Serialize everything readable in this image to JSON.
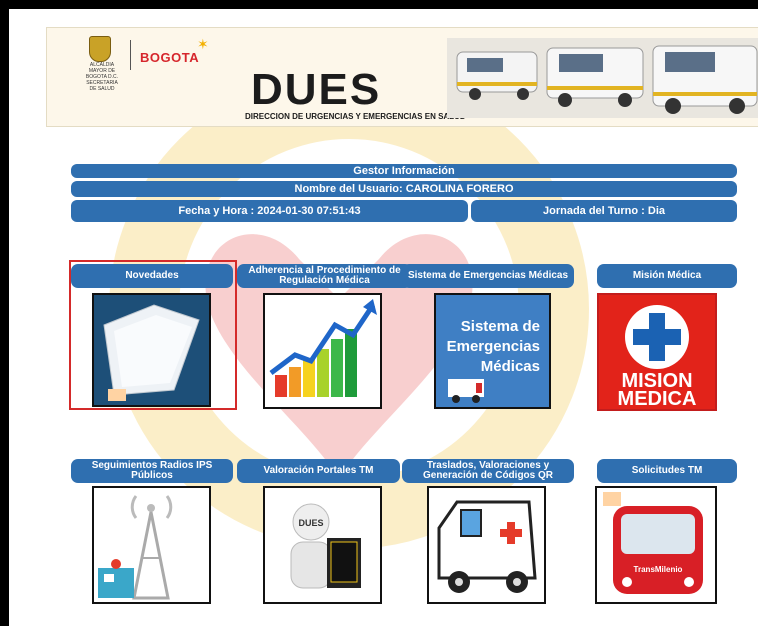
{
  "banner": {
    "institution_text": "ALCALDIA MAYOR DE BOGOTA D.C. SECRETARIA DE SALUD",
    "city_logo": "BOGOTA",
    "title": "DUES",
    "subtitle": "DIRECCION DE URGENCIAS Y EMERGENCIAS EN SALUD"
  },
  "info": {
    "gestor_label": "Gestor Información",
    "usuario": "Nombre del Usuario: CAROLINA FORERO",
    "fecha_hora": "Fecha y Hora : 2024-01-30 07:51:43",
    "jornada": "Jornada del Turno : Dia"
  },
  "tiles": [
    {
      "label": "Novedades",
      "icon": "notebook-icon"
    },
    {
      "label": "Adherencia al Procedimiento de Regulación Médica",
      "icon": "growth-chart-icon"
    },
    {
      "label": "Sistema de Emergencias Médicas",
      "icon": "emergency-system-icon",
      "image_text": [
        "Sistema de",
        "Emergencias",
        "Médicas"
      ]
    },
    {
      "label": "Misión Médica",
      "icon": "medical-mission-icon",
      "image_text": [
        "MISION",
        "MEDICA"
      ]
    },
    {
      "label": "Seguimientos Radios IPS Públicos",
      "icon": "radio-tower-icon"
    },
    {
      "label": "Valoración Portales TM",
      "icon": "portal-figure-icon",
      "image_text": [
        "DUES"
      ]
    },
    {
      "label": "Traslados, Valoraciones y Generación de Códigos QR",
      "icon": "ambulance-icon"
    },
    {
      "label": "Solicitudes TM",
      "icon": "bus-icon",
      "image_text": [
        "TransMilenio"
      ]
    }
  ],
  "colors": {
    "accent": "#2f6fb0",
    "selected_border": "#d42a2a",
    "brand_red": "#d6262c"
  }
}
